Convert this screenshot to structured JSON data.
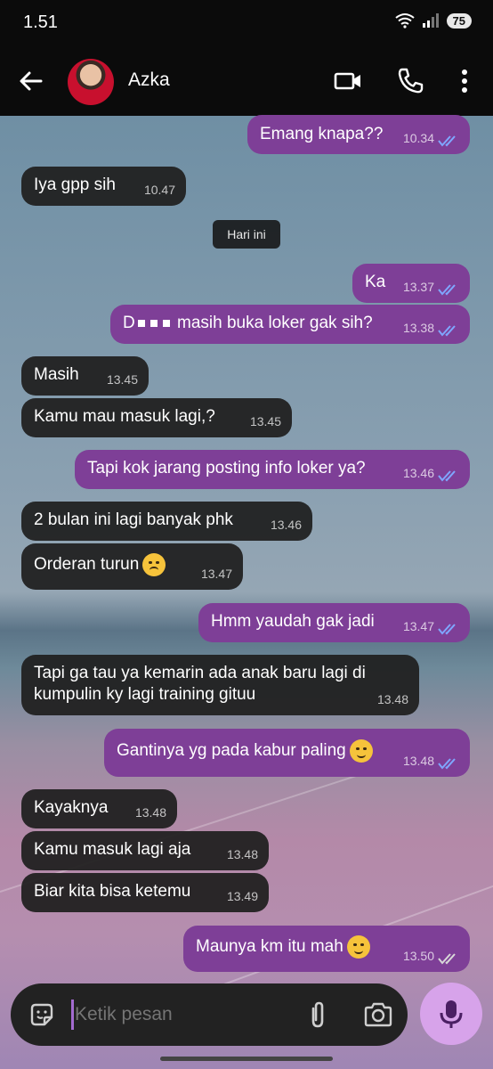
{
  "status_bar": {
    "time": "1.51",
    "battery": "75"
  },
  "header": {
    "contact_name": "Azka"
  },
  "date_divider": "Hari ini",
  "messages": [
    {
      "dir": "out",
      "text": "Emang knapa??",
      "time": "10.34"
    },
    {
      "dir": "in",
      "text": "Iya gpp sih",
      "time": "10.47"
    },
    {
      "dir": "out",
      "text": "Ka",
      "time": "13.37"
    },
    {
      "dir": "out",
      "text_prefix": "D",
      "text": "masih buka loker gak sih?",
      "time": "13.38"
    },
    {
      "dir": "in",
      "text": "Masih",
      "time": "13.45"
    },
    {
      "dir": "in",
      "text": "Kamu mau masuk lagi,?",
      "time": "13.45"
    },
    {
      "dir": "out",
      "text": "Tapi kok jarang posting info loker ya?",
      "time": "13.46"
    },
    {
      "dir": "in",
      "text": "2 bulan ini lagi banyak phk",
      "time": "13.46"
    },
    {
      "dir": "in",
      "text": "Orderan turun",
      "time": "13.47",
      "emoji": "sad-face"
    },
    {
      "dir": "out",
      "text": "Hmm yaudah gak jadi",
      "time": "13.47"
    },
    {
      "dir": "in",
      "text_line1": "Tapi ga tau ya kemarin ada anak baru lagi di",
      "text_line2": "kumpulin ky lagi training gituu",
      "time": "13.48"
    },
    {
      "dir": "out",
      "text": "Gantinya yg pada kabur paling",
      "time": "13.48",
      "emoji": "relieved-face"
    },
    {
      "dir": "in",
      "text": "Kayaknya",
      "time": "13.48"
    },
    {
      "dir": "in",
      "text": "Kamu masuk lagi aja",
      "time": "13.48"
    },
    {
      "dir": "in",
      "text": "Biar kita bisa ketemu",
      "time": "13.49"
    },
    {
      "dir": "out",
      "text": "Maunya km itu mah",
      "time": "13.50",
      "emoji": "relieved-face"
    }
  ],
  "composer": {
    "placeholder": "Ketik pesan"
  },
  "colors": {
    "outgoing": "#7e3f97",
    "incoming": "#202020",
    "tick_read": "#7fa7ff",
    "mic_button": "#d7a3ea"
  }
}
